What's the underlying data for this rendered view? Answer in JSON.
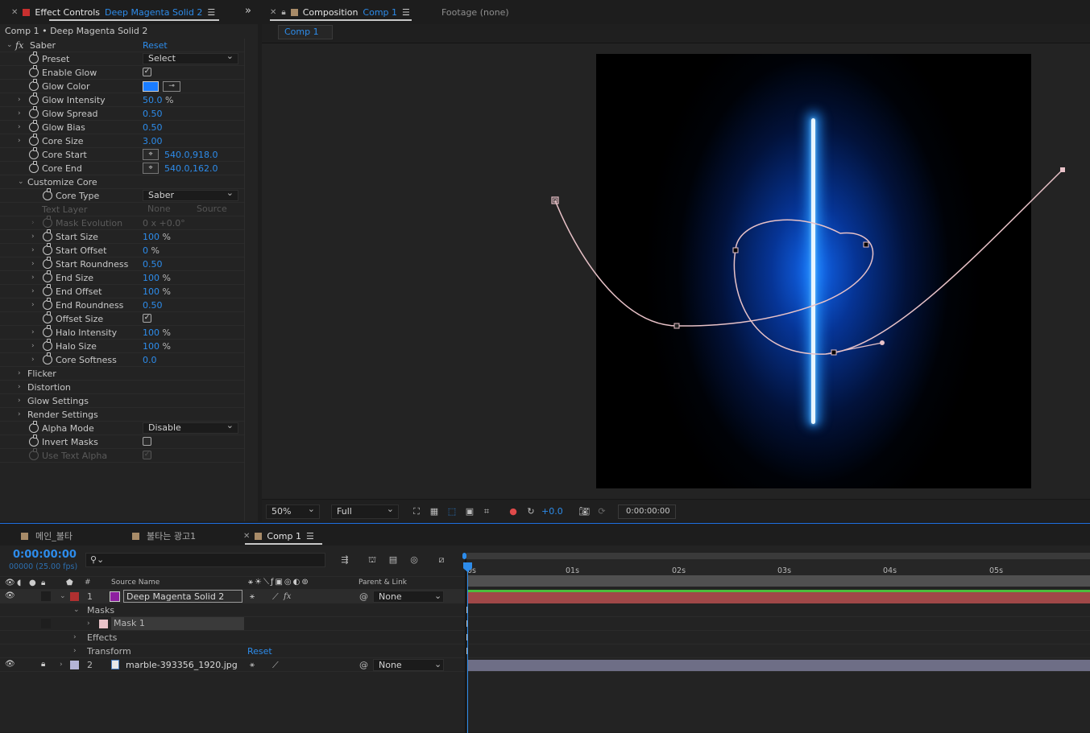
{
  "effect_controls": {
    "tab_prefix": "Effect Controls",
    "tab_layer": "Deep Magenta Solid 2",
    "breadcrumb": "Comp 1 • Deep Magenta Solid 2",
    "effect_name": "Saber",
    "reset_label": "Reset",
    "preset": {
      "label": "Preset",
      "value": "Select"
    },
    "enable_glow": {
      "label": "Enable Glow",
      "checked": true
    },
    "glow_color": {
      "label": "Glow Color",
      "color": "#1a7cff"
    },
    "glow_intensity": {
      "label": "Glow Intensity",
      "value": "50.0",
      "unit": "%"
    },
    "glow_spread": {
      "label": "Glow Spread",
      "value": "0.50"
    },
    "glow_bias": {
      "label": "Glow Bias",
      "value": "0.50"
    },
    "core_size": {
      "label": "Core Size",
      "value": "3.00"
    },
    "core_start": {
      "label": "Core Start",
      "x": "540.0",
      "y": "918.0"
    },
    "core_end": {
      "label": "Core End",
      "x": "540.0",
      "y": "162.0"
    },
    "customize_core": {
      "label": "Customize Core"
    },
    "core_type": {
      "label": "Core Type",
      "value": "Saber"
    },
    "text_layer": {
      "label": "Text Layer",
      "value": "None",
      "value2": "Source"
    },
    "mask_evolution": {
      "label": "Mask Evolution",
      "value": "0 x +0.0°"
    },
    "start_size": {
      "label": "Start Size",
      "value": "100",
      "unit": "%"
    },
    "start_offset": {
      "label": "Start Offset",
      "value": "0",
      "unit": "%"
    },
    "start_roundness": {
      "label": "Start Roundness",
      "value": "0.50"
    },
    "end_size": {
      "label": "End Size",
      "value": "100",
      "unit": "%"
    },
    "end_offset": {
      "label": "End Offset",
      "value": "100",
      "unit": "%"
    },
    "end_roundness": {
      "label": "End Roundness",
      "value": "0.50"
    },
    "offset_size": {
      "label": "Offset Size",
      "checked": true
    },
    "halo_intensity": {
      "label": "Halo Intensity",
      "value": "100",
      "unit": "%"
    },
    "halo_size": {
      "label": "Halo Size",
      "value": "100",
      "unit": "%"
    },
    "core_softness": {
      "label": "Core Softness",
      "value": "0.0"
    },
    "flicker": {
      "label": "Flicker"
    },
    "distortion": {
      "label": "Distortion"
    },
    "glow_settings": {
      "label": "Glow Settings"
    },
    "render_settings": {
      "label": "Render Settings"
    },
    "alpha_mode": {
      "label": "Alpha Mode",
      "value": "Disable"
    },
    "invert_masks": {
      "label": "Invert Masks",
      "checked": false
    },
    "use_text_alpha": {
      "label": "Use Text Alpha",
      "checked": true
    }
  },
  "composition": {
    "tab_prefix": "Composition",
    "tab_comp": "Comp 1",
    "footage_tab": "Footage (none)",
    "sub_tab": "Comp 1",
    "zoom": "50%",
    "resolution": "Full",
    "exposure": "+0.0",
    "timecode": "0:00:00:00"
  },
  "timeline": {
    "tabs": [
      {
        "label": "메인_불타",
        "color": "#a88b68"
      },
      {
        "label": "불타는 광고1",
        "color": "#a88b68"
      },
      {
        "label": "Comp 1",
        "color": "#a88b68"
      }
    ],
    "timecode": "0:00:00:00",
    "frame_info": "00000 (25.00 fps)",
    "search_placeholder": "",
    "col_hash": "#",
    "col_source": "Source Name",
    "col_parent": "Parent & Link",
    "ruler": [
      "0s",
      "01s",
      "02s",
      "03s",
      "04s",
      "05s"
    ],
    "layers": [
      {
        "num": "1",
        "name": "Deep Magenta Solid 2",
        "label_color": "#b03030",
        "parent": "None"
      },
      {
        "num": "2",
        "name": "marble-393356_1920.jpg",
        "label_color": "#b4b4d8",
        "parent": "None"
      }
    ],
    "masks_label": "Masks",
    "mask1_label": "Mask 1",
    "effects_label": "Effects",
    "transform_label": "Transform",
    "reset_label": "Reset"
  }
}
